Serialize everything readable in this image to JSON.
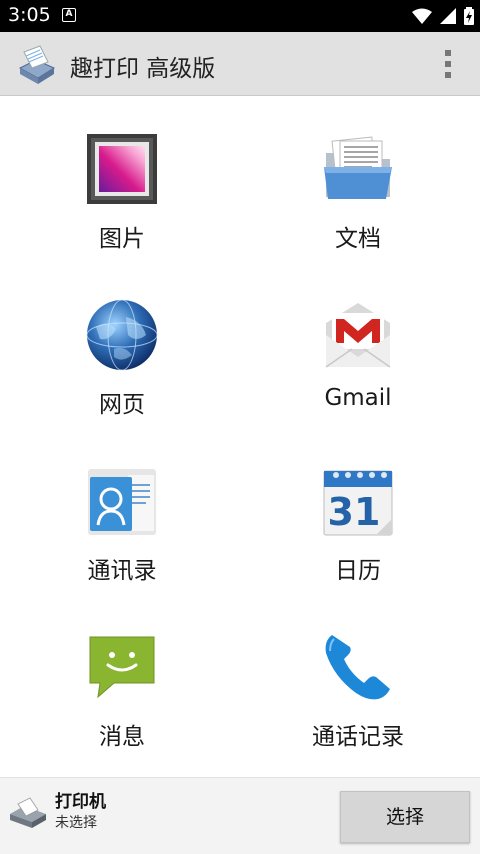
{
  "status_bar": {
    "time": "3:05",
    "notification_icon": "a-icon",
    "icons": [
      "wifi-icon",
      "signal-icon",
      "battery-charging-icon"
    ]
  },
  "app_bar": {
    "title": "趣打印 高级版",
    "logo_icon": "printer-logo-icon",
    "menu_icon": "overflow-menu-icon"
  },
  "tiles": [
    {
      "label": "图片",
      "icon": "photo-icon"
    },
    {
      "label": "文档",
      "icon": "folder-documents-icon"
    },
    {
      "label": "网页",
      "icon": "globe-icon"
    },
    {
      "label": "Gmail",
      "icon": "gmail-icon"
    },
    {
      "label": "通讯录",
      "icon": "contacts-icon"
    },
    {
      "label": "日历",
      "icon": "calendar-icon",
      "calendar_day": "31"
    },
    {
      "label": "消息",
      "icon": "message-icon"
    },
    {
      "label": "通话记录",
      "icon": "phone-icon"
    }
  ],
  "bottom_bar": {
    "printer_label": "打印机",
    "printer_status": "未选择",
    "select_button": "选择"
  },
  "colors": {
    "status_bar": "#000000",
    "app_bar": "#e1e1e1",
    "bottom_bar": "#f3f3f3",
    "button": "#d6d6d6"
  }
}
